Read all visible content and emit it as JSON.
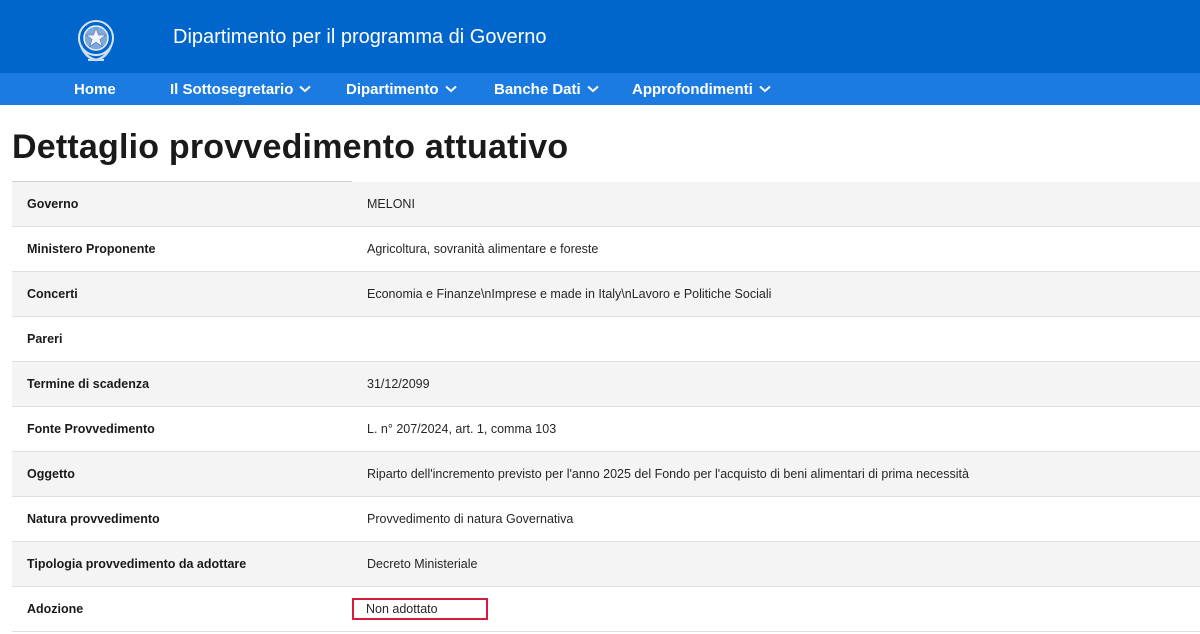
{
  "header": {
    "site_title": "Dipartimento per il programma di Governo"
  },
  "nav": {
    "items": [
      {
        "label": "Home",
        "has_dropdown": false
      },
      {
        "label": "Il Sottosegretario",
        "has_dropdown": true
      },
      {
        "label": "Dipartimento",
        "has_dropdown": true
      },
      {
        "label": "Banche Dati",
        "has_dropdown": true
      },
      {
        "label": "Approfondimenti",
        "has_dropdown": true
      }
    ]
  },
  "main": {
    "title": "Dettaglio provvedimento attuativo",
    "rows": [
      {
        "label": "Governo",
        "value": "MELONI"
      },
      {
        "label": "Ministero Proponente",
        "value": "Agricoltura, sovranità alimentare e foreste"
      },
      {
        "label": "Concerti",
        "value": "Economia e Finanze\\nImprese e made in Italy\\nLavoro e Politiche Sociali"
      },
      {
        "label": "Pareri",
        "value": ""
      },
      {
        "label": "Termine di scadenza",
        "value": "31/12/2099"
      },
      {
        "label": "Fonte Provvedimento",
        "value": "L. n° 207/2024, art. 1, comma 103"
      },
      {
        "label": "Oggetto",
        "value": "Riparto dell'incremento previsto per l'anno 2025 del Fondo per l'acquisto di beni alimentari di prima necessità"
      },
      {
        "label": "Natura provvedimento",
        "value": "Provvedimento di natura Governativa"
      },
      {
        "label": "Tipologia provvedimento da adottare",
        "value": "Decreto Ministeriale"
      },
      {
        "label": "Adozione",
        "value": "Non adottato"
      }
    ]
  },
  "colors": {
    "header_bg": "#0066cc",
    "nav_bg": "#1b7be0",
    "highlight_border": "#d81b3c"
  },
  "icons": {
    "emblem": "italian-republic-emblem-icon",
    "dropdown": "chevron-down-icon"
  }
}
